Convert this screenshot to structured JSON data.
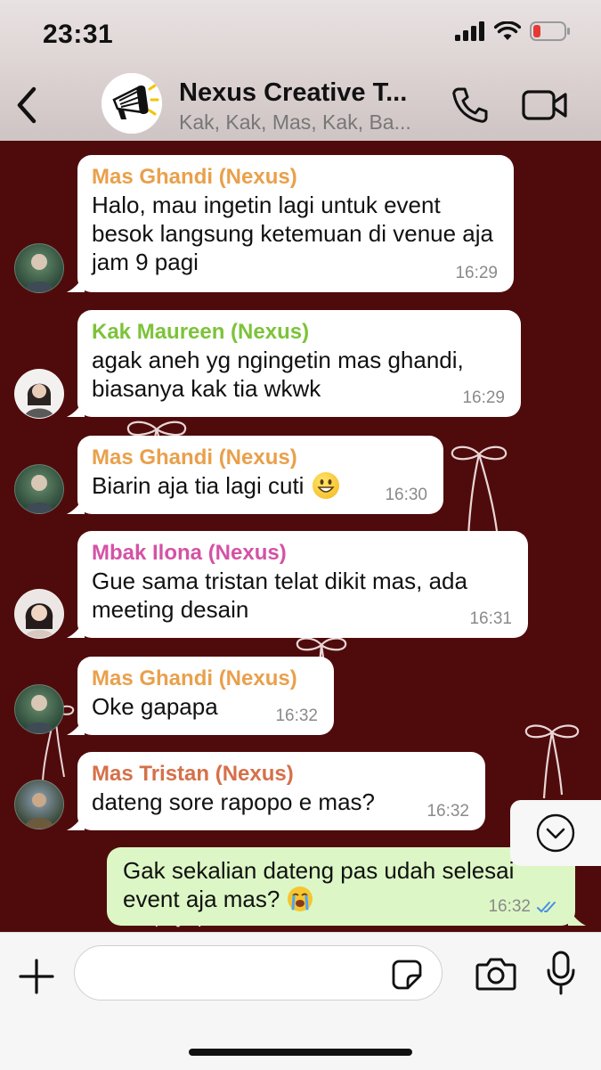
{
  "status_bar": {
    "time": "23:31"
  },
  "header": {
    "title": "Nexus Creative T...",
    "subtitle": "Kak, Kak, Mas, Kak, Ba..."
  },
  "colors": {
    "chat_background": "#4f0b0c",
    "outgoing_bubble": "#dcf7c5",
    "sender_ghandi": "#e9a04b",
    "sender_maureen": "#7cc33a",
    "sender_ilona": "#d452a5",
    "sender_tristan": "#d5704a",
    "read_ticks": "#4a90e2"
  },
  "messages": [
    {
      "sender": "Mas Ghandi (Nexus)",
      "text": "Halo, mau ingetin lagi untuk event besok langsung ketemuan di venue aja jam 9 pagi",
      "time": "16:29"
    },
    {
      "sender": "Kak Maureen (Nexus)",
      "text": "agak aneh yg ngingetin mas ghandi, biasanya kak tia wkwk",
      "time": "16:29"
    },
    {
      "sender": "Mas Ghandi (Nexus)",
      "text": "Biarin aja tia lagi cuti",
      "emoji": "grinning-face",
      "time": "16:30"
    },
    {
      "sender": "Mbak Ilona (Nexus)",
      "text": "Gue sama tristan telat dikit mas, ada meeting desain",
      "time": "16:31"
    },
    {
      "sender": "Mas Ghandi (Nexus)",
      "text": "Oke gapapa",
      "time": "16:32"
    },
    {
      "sender": "Mas Tristan (Nexus)",
      "text": "dateng sore rapopo e mas?",
      "time": "16:32"
    }
  ],
  "outgoing": {
    "text": "Gak sekalian dateng pas udah selesai event aja mas?",
    "emoji": "loudly-crying-face",
    "time": "16:32",
    "status": "read"
  },
  "input": {
    "placeholder": ""
  }
}
